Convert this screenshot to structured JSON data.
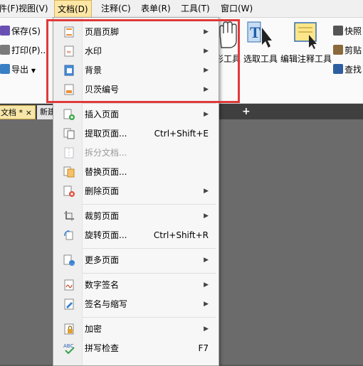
{
  "menubar": {
    "items": [
      {
        "label": "件(F)"
      },
      {
        "label": "视图(V)"
      },
      {
        "label": "文档(D)"
      },
      {
        "label": "注释(C)"
      },
      {
        "label": "表单(R)"
      },
      {
        "label": "工具(T)"
      },
      {
        "label": "窗口(W)"
      }
    ]
  },
  "toolbar": {
    "save_label": "保存(S)",
    "print_label": "打印(P)...",
    "export_label": "导出",
    "shape_tool_label": "形工具",
    "select_tool_label": "选取工具",
    "edit_annot_label": "编辑注释工具",
    "snapshot_label": "快照",
    "clip_label": "剪贴",
    "find_label": "查找"
  },
  "tabs": {
    "tab1": "文档 *",
    "tab1_close": "×",
    "tab2": "新建",
    "add": "+"
  },
  "menu": {
    "header_footer": "页眉页脚",
    "watermark": "水印",
    "background": "背景",
    "bates": "贝茨编号",
    "insert_page": "插入页面",
    "extract_page": "提取页面...",
    "extract_sc": "Ctrl+Shift+E",
    "split_doc": "拆分文档...",
    "replace_page": "替换页面...",
    "delete_page": "删除页面",
    "crop_page": "裁剪页面",
    "rotate_page": "旋转页面...",
    "rotate_sc": "Ctrl+Shift+R",
    "more_pages": "更多页面",
    "digital_sign": "数字签名",
    "sign_initial": "签名与缩写",
    "encrypt": "加密",
    "spell_check": "拼写检查",
    "spell_sc": "F7",
    "arrow": "▶"
  },
  "colors": {
    "highlight": "#e03a3a",
    "menu_active": "#fde7a6"
  }
}
